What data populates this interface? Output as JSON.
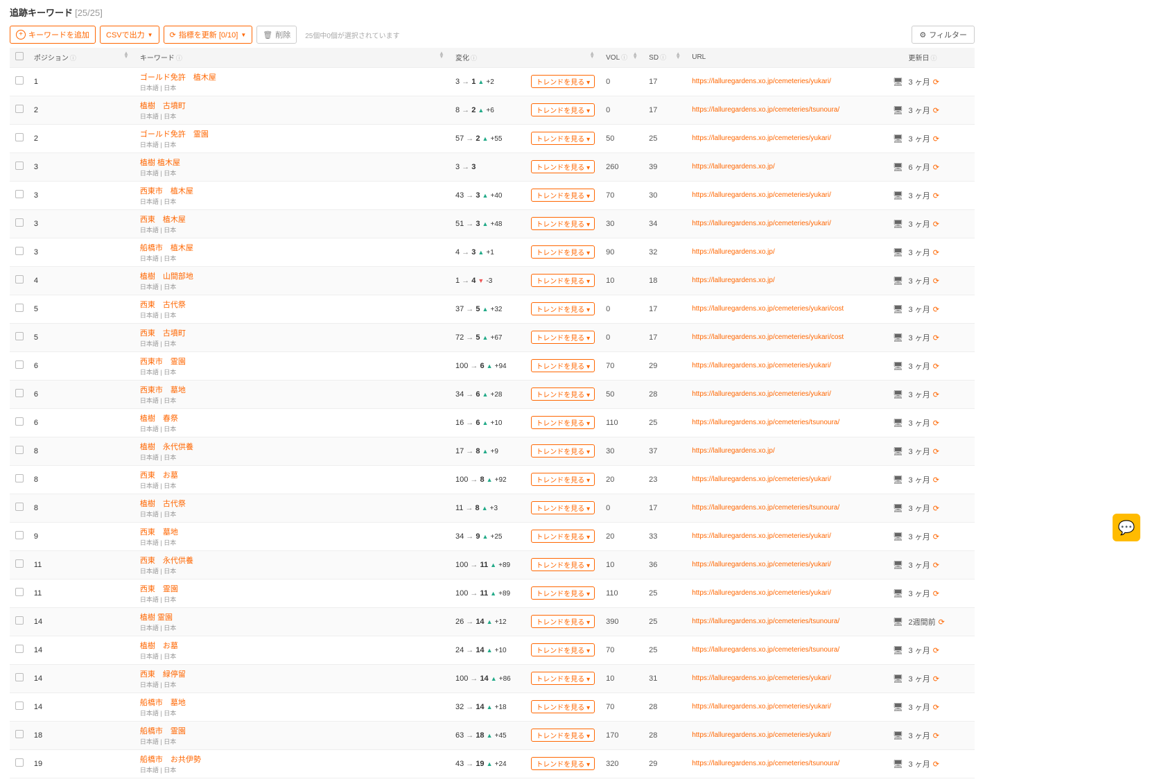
{
  "title": "追跡キーワード",
  "title_count": "[25/25]",
  "toolbar": {
    "add": "キーワードを追加",
    "csv": "CSVで出力",
    "rerank": "指標を更新 [0/10]",
    "delete": "削除",
    "selected": "25個中0個が選択されています",
    "filter": "フィルター"
  },
  "headers": {
    "position": "ポジション",
    "keyword": "キーワード",
    "change": "変化",
    "vol": "VOL",
    "sd": "SD",
    "url": "URL",
    "updated": "更新日"
  },
  "kw_meta": "日本語 | 日本",
  "trend_label": "トレンドを見る",
  "rows": [
    {
      "pos": "1",
      "kw": "ゴールド免許　植木屋",
      "from": "3",
      "to": "1",
      "dir": "up",
      "delta": "+2",
      "vol": "0",
      "sd": "17",
      "url": "https://lalluregardens.xo.jp/cemeteries/yukari/",
      "upd": "3 ヶ月"
    },
    {
      "pos": "2",
      "kw": "植樹　古墳町",
      "from": "8",
      "to": "2",
      "dir": "up",
      "delta": "+6",
      "vol": "0",
      "sd": "17",
      "url": "https://lalluregardens.xo.jp/cemeteries/tsunoura/",
      "upd": "3 ヶ月"
    },
    {
      "pos": "2",
      "kw": "ゴールド免許　霊園",
      "from": "57",
      "to": "2",
      "dir": "up",
      "delta": "+55",
      "vol": "50",
      "sd": "25",
      "url": "https://lalluregardens.xo.jp/cemeteries/yukari/",
      "upd": "3 ヶ月"
    },
    {
      "pos": "3",
      "kw": "植樹 植木屋",
      "from": "3",
      "to": "3",
      "dir": "",
      "delta": "",
      "vol": "260",
      "sd": "39",
      "url": "https://lalluregardens.xo.jp/",
      "upd": "6 ヶ月"
    },
    {
      "pos": "3",
      "kw": "西東市　植木屋",
      "from": "43",
      "to": "3",
      "dir": "up",
      "delta": "+40",
      "vol": "70",
      "sd": "30",
      "url": "https://lalluregardens.xo.jp/cemeteries/yukari/",
      "upd": "3 ヶ月"
    },
    {
      "pos": "3",
      "kw": "西東　植木屋",
      "from": "51",
      "to": "3",
      "dir": "up",
      "delta": "+48",
      "vol": "30",
      "sd": "34",
      "url": "https://lalluregardens.xo.jp/cemeteries/yukari/",
      "upd": "3 ヶ月"
    },
    {
      "pos": "3",
      "kw": "船橋市　植木屋",
      "from": "4",
      "to": "3",
      "dir": "up",
      "delta": "+1",
      "vol": "90",
      "sd": "32",
      "url": "https://lalluregardens.xo.jp/",
      "upd": "3 ヶ月"
    },
    {
      "pos": "4",
      "kw": "植樹　山間部地",
      "from": "1",
      "to": "4",
      "dir": "down",
      "delta": "-3",
      "vol": "10",
      "sd": "18",
      "url": "https://lalluregardens.xo.jp/",
      "upd": "3 ヶ月"
    },
    {
      "pos": "5",
      "kw": "西東　古代祭",
      "from": "37",
      "to": "5",
      "dir": "up",
      "delta": "+32",
      "vol": "0",
      "sd": "17",
      "url": "https://lalluregardens.xo.jp/cemeteries/yukari/cost",
      "upd": "3 ヶ月"
    },
    {
      "pos": "5",
      "kw": "西東　古墳町",
      "from": "72",
      "to": "5",
      "dir": "up",
      "delta": "+67",
      "vol": "0",
      "sd": "17",
      "url": "https://lalluregardens.xo.jp/cemeteries/yukari/cost",
      "upd": "3 ヶ月"
    },
    {
      "pos": "6",
      "kw": "西東市　霊園",
      "from": "100",
      "to": "6",
      "dir": "up",
      "delta": "+94",
      "vol": "70",
      "sd": "29",
      "url": "https://lalluregardens.xo.jp/cemeteries/yukari/",
      "upd": "3 ヶ月"
    },
    {
      "pos": "6",
      "kw": "西東市　墓地",
      "from": "34",
      "to": "6",
      "dir": "up",
      "delta": "+28",
      "vol": "50",
      "sd": "28",
      "url": "https://lalluregardens.xo.jp/cemeteries/yukari/",
      "upd": "3 ヶ月"
    },
    {
      "pos": "6",
      "kw": "植樹　春祭",
      "from": "16",
      "to": "6",
      "dir": "up",
      "delta": "+10",
      "vol": "110",
      "sd": "25",
      "url": "https://lalluregardens.xo.jp/cemeteries/tsunoura/",
      "upd": "3 ヶ月"
    },
    {
      "pos": "8",
      "kw": "植樹　永代供養",
      "from": "17",
      "to": "8",
      "dir": "up",
      "delta": "+9",
      "vol": "30",
      "sd": "37",
      "url": "https://lalluregardens.xo.jp/",
      "upd": "3 ヶ月"
    },
    {
      "pos": "8",
      "kw": "西東　お墓",
      "from": "100",
      "to": "8",
      "dir": "up",
      "delta": "+92",
      "vol": "20",
      "sd": "23",
      "url": "https://lalluregardens.xo.jp/cemeteries/yukari/",
      "upd": "3 ヶ月"
    },
    {
      "pos": "8",
      "kw": "植樹　古代祭",
      "from": "11",
      "to": "8",
      "dir": "up",
      "delta": "+3",
      "vol": "0",
      "sd": "17",
      "url": "https://lalluregardens.xo.jp/cemeteries/tsunoura/",
      "upd": "3 ヶ月"
    },
    {
      "pos": "9",
      "kw": "西東　墓地",
      "from": "34",
      "to": "9",
      "dir": "up",
      "delta": "+25",
      "vol": "20",
      "sd": "33",
      "url": "https://lalluregardens.xo.jp/cemeteries/yukari/",
      "upd": "3 ヶ月"
    },
    {
      "pos": "11",
      "kw": "西東　永代供養",
      "from": "100",
      "to": "11",
      "dir": "up",
      "delta": "+89",
      "vol": "10",
      "sd": "36",
      "url": "https://lalluregardens.xo.jp/cemeteries/yukari/",
      "upd": "3 ヶ月"
    },
    {
      "pos": "11",
      "kw": "西東　霊園",
      "from": "100",
      "to": "11",
      "dir": "up",
      "delta": "+89",
      "vol": "110",
      "sd": "25",
      "url": "https://lalluregardens.xo.jp/cemeteries/yukari/",
      "upd": "3 ヶ月"
    },
    {
      "pos": "14",
      "kw": "植樹 霊園",
      "from": "26",
      "to": "14",
      "dir": "up",
      "delta": "+12",
      "vol": "390",
      "sd": "25",
      "url": "https://lalluregardens.xo.jp/cemeteries/tsunoura/",
      "upd": "2週間前"
    },
    {
      "pos": "14",
      "kw": "植樹　お墓",
      "from": "24",
      "to": "14",
      "dir": "up",
      "delta": "+10",
      "vol": "70",
      "sd": "25",
      "url": "https://lalluregardens.xo.jp/cemeteries/tsunoura/",
      "upd": "3 ヶ月"
    },
    {
      "pos": "14",
      "kw": "西東　緑停留",
      "from": "100",
      "to": "14",
      "dir": "up",
      "delta": "+86",
      "vol": "10",
      "sd": "31",
      "url": "https://lalluregardens.xo.jp/cemeteries/yukari/",
      "upd": "3 ヶ月"
    },
    {
      "pos": "14",
      "kw": "船橋市　墓地",
      "from": "32",
      "to": "14",
      "dir": "up",
      "delta": "+18",
      "vol": "70",
      "sd": "28",
      "url": "https://lalluregardens.xo.jp/cemeteries/yukari/",
      "upd": "3 ヶ月"
    },
    {
      "pos": "18",
      "kw": "船橋市　霊園",
      "from": "63",
      "to": "18",
      "dir": "up",
      "delta": "+45",
      "vol": "170",
      "sd": "28",
      "url": "https://lalluregardens.xo.jp/cemeteries/yukari/",
      "upd": "3 ヶ月"
    },
    {
      "pos": "19",
      "kw": "船橋市　お共伊勢",
      "from": "43",
      "to": "19",
      "dir": "up",
      "delta": "+24",
      "vol": "320",
      "sd": "29",
      "url": "https://lalluregardens.xo.jp/cemeteries/tsunoura/",
      "upd": "3 ヶ月"
    }
  ]
}
